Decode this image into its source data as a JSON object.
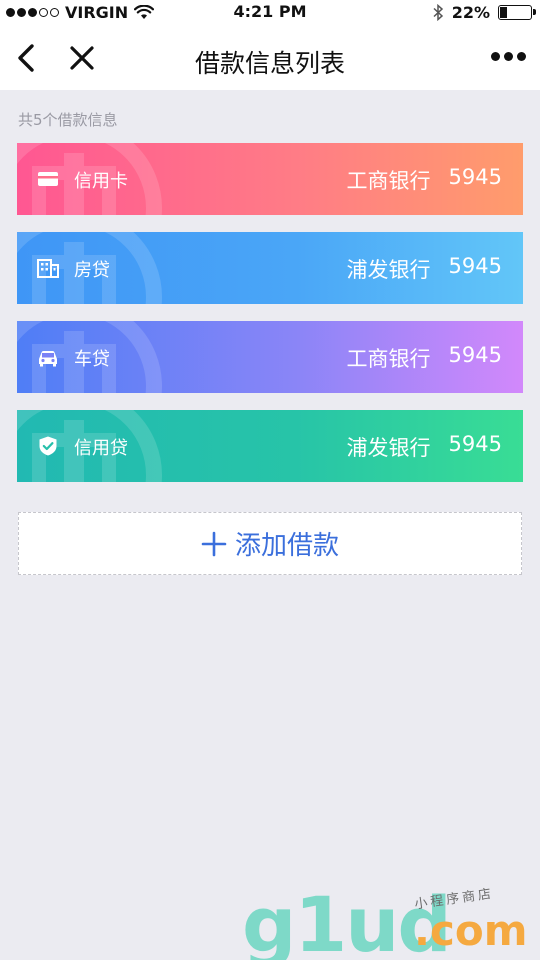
{
  "status_bar": {
    "carrier": "VIRGIN",
    "time": "4:21 PM",
    "battery_percent": "22%",
    "battery_level": 0.22,
    "signal_bars": 3,
    "signal_total": 5
  },
  "nav": {
    "title": "借款信息列表",
    "back_icon": "chevron-left-icon",
    "close_icon": "close-icon",
    "more_icon": "more-dots-icon"
  },
  "summary": {
    "count_text": "共5个借款信息"
  },
  "loans": [
    {
      "type": "信用卡",
      "bank": "工商银行",
      "number": "5945",
      "icon": "card-icon"
    },
    {
      "type": "房贷",
      "bank": "浦发银行",
      "number": "5945",
      "icon": "building-icon"
    },
    {
      "type": "车贷",
      "bank": "工商银行",
      "number": "5945",
      "icon": "car-icon"
    },
    {
      "type": "信用贷",
      "bank": "浦发银行",
      "number": "5945",
      "icon": "shield-check-icon"
    }
  ],
  "add_button": {
    "label": "添加借款",
    "icon": "plus-icon"
  },
  "brand": {
    "logo_main": "g1ud",
    "logo_domain": ".com",
    "logo_tagline": "小程序商店"
  }
}
